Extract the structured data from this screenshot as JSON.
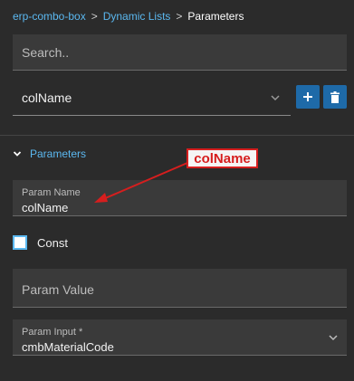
{
  "breadcrumb": {
    "items": [
      "erp-combo-box",
      "Dynamic Lists"
    ],
    "separator": ">",
    "current": "Parameters"
  },
  "search": {
    "placeholder": "Search..",
    "value": ""
  },
  "combo": {
    "value": "colName",
    "icon": "chevron-down-icon"
  },
  "actions": {
    "add_icon": "plus-icon",
    "delete_icon": "trash-icon"
  },
  "section": {
    "title": "Parameters",
    "expanded": true
  },
  "fields": {
    "param_name": {
      "label": "Param Name",
      "value": "colName"
    },
    "const": {
      "label": "Const",
      "checked": false
    },
    "param_value": {
      "placeholder": "Param Value",
      "value": ""
    },
    "param_input": {
      "label": "Param Input *",
      "value": "cmbMaterialCode"
    }
  },
  "annotation": {
    "text": "colName",
    "color": "#d61e1e"
  },
  "colors": {
    "background": "#2b2b2b",
    "accent": "#5bb8f0",
    "button": "#1e6aa8"
  }
}
